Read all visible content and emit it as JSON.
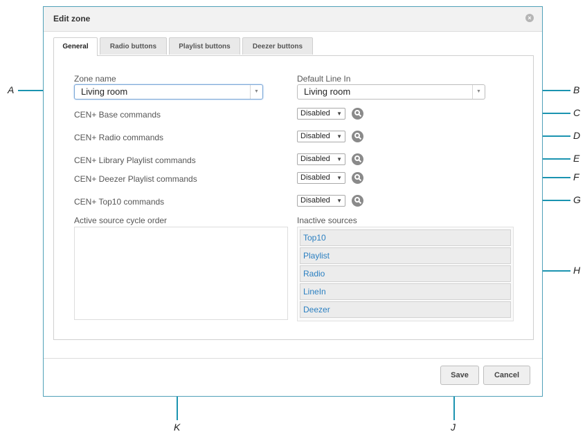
{
  "dialog": {
    "title": "Edit zone",
    "close_icon": "close-icon"
  },
  "tabs": [
    {
      "label": "General",
      "active": true
    },
    {
      "label": "Radio buttons",
      "active": false
    },
    {
      "label": "Playlist buttons",
      "active": false
    },
    {
      "label": "Deezer buttons",
      "active": false
    }
  ],
  "form": {
    "zone_name_label": "Zone name",
    "zone_name_value": "Living room",
    "default_line_in_label": "Default Line In",
    "default_line_in_value": "Living room",
    "commands": [
      {
        "label": "CEN+ Base commands",
        "value": "Disabled"
      },
      {
        "label": "CEN+ Radio commands",
        "value": "Disabled"
      },
      {
        "label": "CEN+ Library Playlist commands",
        "value": "Disabled"
      },
      {
        "label": "CEN+ Deezer Playlist commands",
        "value": "Disabled"
      },
      {
        "label": "CEN+ Top10 commands",
        "value": "Disabled"
      }
    ],
    "active_sources_label": "Active source cycle order",
    "inactive_sources_label": "Inactive sources",
    "inactive_sources": [
      "Top10",
      "Playlist",
      "Radio",
      "LineIn",
      "Deezer"
    ]
  },
  "buttons": {
    "save": "Save",
    "cancel": "Cancel"
  },
  "callouts": [
    "A",
    "B",
    "C",
    "D",
    "E",
    "F",
    "G",
    "H",
    "J",
    "K"
  ],
  "colors": {
    "callout_line": "#1a93b0",
    "link_text": "#2a7fc1",
    "dialog_border": "#4fa0b8"
  }
}
